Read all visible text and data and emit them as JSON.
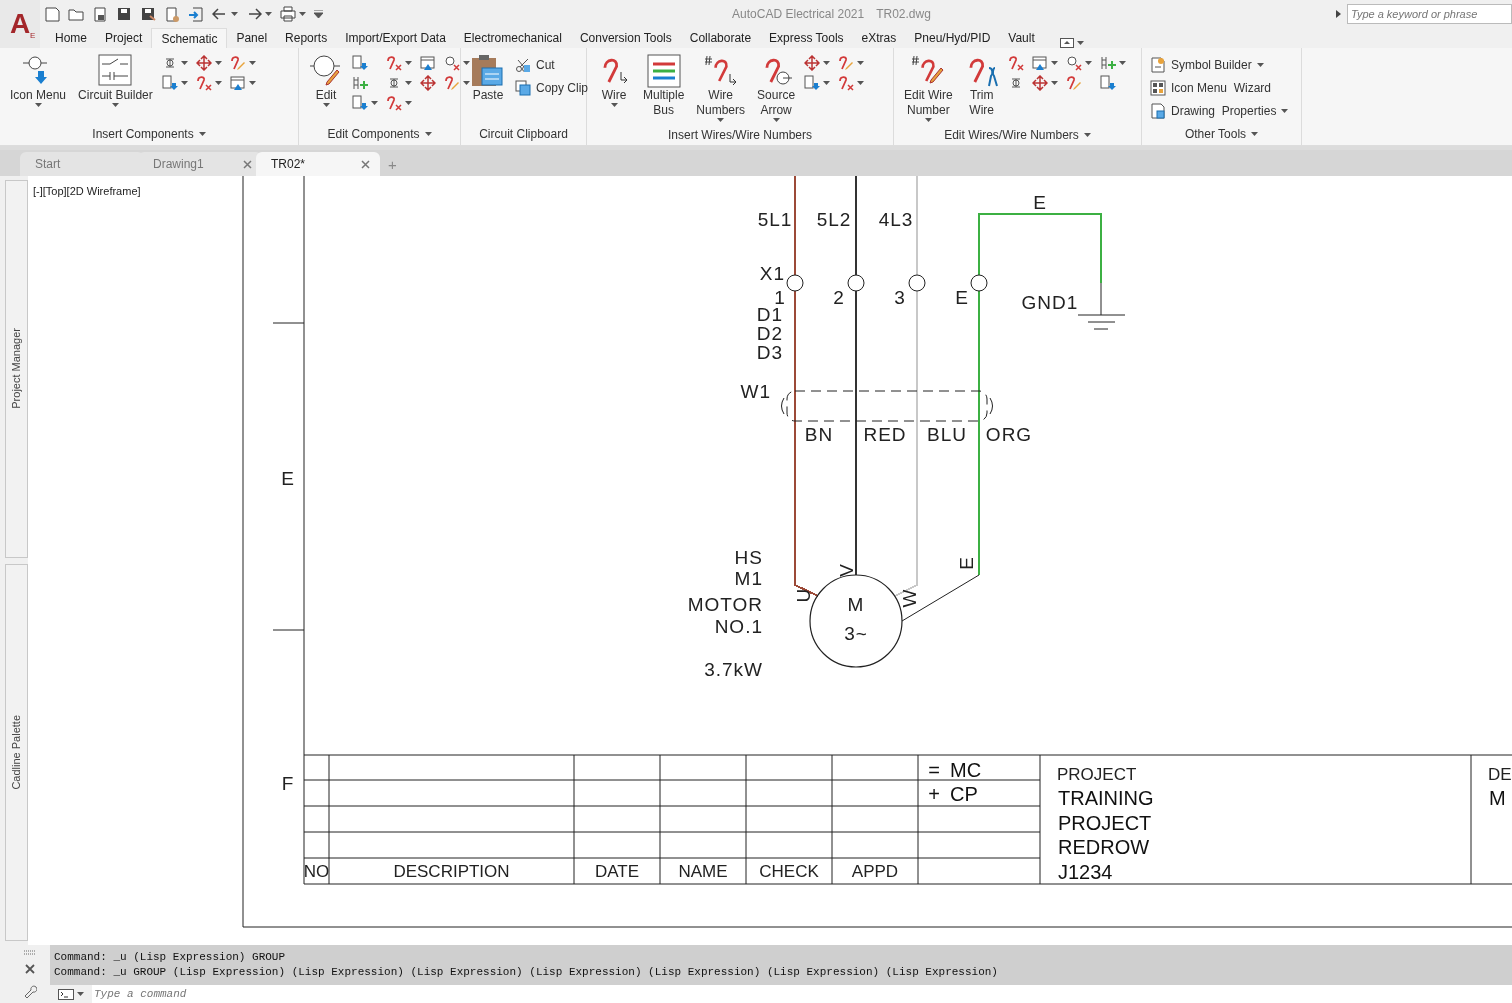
{
  "app": {
    "logo": "A",
    "logo_sub": "E",
    "title": "AutoCAD Electrical 2021",
    "file": "TR02.dwg"
  },
  "search": {
    "placeholder": "Type a keyword or phrase"
  },
  "ribbon_tabs": [
    {
      "label": "Home",
      "selected": false
    },
    {
      "label": "Project",
      "selected": false
    },
    {
      "label": "Schematic",
      "selected": true
    },
    {
      "label": "Panel",
      "selected": false
    },
    {
      "label": "Reports",
      "selected": false
    },
    {
      "label": "Import/Export Data",
      "selected": false
    },
    {
      "label": "Electromechanical",
      "selected": false
    },
    {
      "label": "Conversion Tools",
      "selected": false
    },
    {
      "label": "Collaborate",
      "selected": false
    },
    {
      "label": "Express Tools",
      "selected": false
    },
    {
      "label": "eXtras",
      "selected": false
    },
    {
      "label": "Pneu/Hyd/PID",
      "selected": false
    },
    {
      "label": "Vault",
      "selected": false
    }
  ],
  "ribbon_panels": [
    {
      "title": "Insert Components",
      "menu": true,
      "tools": [
        {
          "kind": "large",
          "label": "Icon Menu",
          "menu": true
        },
        {
          "kind": "large",
          "label": "Circuit Builder",
          "menu": true
        },
        {
          "kind": "icon",
          "menu": true
        },
        {
          "kind": "icon",
          "menu": true
        },
        {
          "kind": "icon",
          "menu": true
        },
        {
          "kind": "icon",
          "menu": true
        },
        {
          "kind": "icon",
          "menu": true
        },
        {
          "kind": "icon",
          "menu": true
        }
      ]
    },
    {
      "title": "Edit Components",
      "menu": true,
      "tools": [
        {
          "kind": "large",
          "label": "Edit",
          "menu": true
        },
        {
          "kind": "icon",
          "menu": false
        },
        {
          "kind": "icon",
          "menu": true
        },
        {
          "kind": "icon",
          "menu": false
        },
        {
          "kind": "icon",
          "menu": true
        },
        {
          "kind": "icon",
          "menu": false
        },
        {
          "kind": "icon",
          "menu": true
        },
        {
          "kind": "icon",
          "menu": false
        },
        {
          "kind": "icon",
          "menu": true
        },
        {
          "kind": "icon",
          "menu": true
        },
        {
          "kind": "icon",
          "menu": true
        }
      ]
    },
    {
      "title": "Circuit Clipboard",
      "menu": false,
      "tools": [
        {
          "kind": "large",
          "label": "Paste",
          "menu": false
        },
        {
          "kind": "small",
          "label": "Cut",
          "menu": false
        },
        {
          "kind": "small",
          "label": "Copy Clip",
          "menu": false
        }
      ]
    },
    {
      "title": "Insert Wires/Wire Numbers",
      "menu": false,
      "tools": [
        {
          "kind": "large",
          "label": "Wire",
          "menu": true
        },
        {
          "kind": "large",
          "label": "Multiple\nBus",
          "menu": false
        },
        {
          "kind": "large",
          "label": "Wire\nNumbers",
          "menu": true
        },
        {
          "kind": "large",
          "label": "Source\nArrow",
          "menu": true
        },
        {
          "kind": "icon",
          "menu": true
        },
        {
          "kind": "icon",
          "menu": true
        },
        {
          "kind": "icon",
          "menu": true
        },
        {
          "kind": "icon",
          "menu": true
        }
      ]
    },
    {
      "title": "Edit Wires/Wire Numbers",
      "menu": true,
      "tools": [
        {
          "kind": "large",
          "label": "Edit Wire\nNumber",
          "menu": true
        },
        {
          "kind": "large",
          "label": "Trim\nWire",
          "menu": false
        },
        {
          "kind": "icon",
          "menu": false
        },
        {
          "kind": "icon",
          "menu": true
        },
        {
          "kind": "icon",
          "menu": true
        },
        {
          "kind": "icon",
          "menu": true
        },
        {
          "kind": "icon",
          "menu": false
        },
        {
          "kind": "icon",
          "menu": true
        },
        {
          "kind": "icon",
          "menu": false
        },
        {
          "kind": "icon",
          "menu": false
        }
      ]
    },
    {
      "title": "Other Tools",
      "menu": true,
      "tools": [
        {
          "kind": "small",
          "label": "Symbol Builder",
          "menu": true
        },
        {
          "kind": "small",
          "label": "Icon Menu  Wizard",
          "menu": false
        },
        {
          "kind": "small",
          "label": "Drawing  Properties",
          "menu": true
        }
      ]
    }
  ],
  "document_tabs": [
    {
      "label": "Start",
      "selected": false,
      "closable": false
    },
    {
      "label": "Drawing1",
      "selected": false,
      "closable": true
    },
    {
      "label": "TR02*",
      "selected": true,
      "closable": true
    }
  ],
  "new_tab": "+",
  "side_palettes": [
    "Project Manager",
    "Cadline Palette"
  ],
  "viewport": {
    "label": "[-][Top][2D Wireframe]"
  },
  "schematic": {
    "zones": [
      "E",
      "F"
    ],
    "wires": [
      {
        "label": "5L1",
        "terminal": "1",
        "core": "BN",
        "pin": "U",
        "color": "#9c4a38"
      },
      {
        "label": "5L2",
        "terminal": "2",
        "core": "RED",
        "pin": "V",
        "color": "#333333"
      },
      {
        "label": "4L3",
        "terminal": "3",
        "core": "BLU",
        "pin": "W",
        "color": "#c8c8c8"
      },
      {
        "label": "E",
        "terminal": "E",
        "core": "ORG",
        "pin": "E",
        "color": "#3cb043"
      }
    ],
    "terminal_tag": "X1",
    "terminal_extra": [
      "D1",
      "D2",
      "D3"
    ],
    "cable_tag": "W1",
    "ground_tag": "GND1",
    "motor": {
      "tags": [
        "HS",
        "M1",
        "MOTOR",
        "NO.1"
      ],
      "rating": "3.7kW",
      "symbol": "M",
      "phases": "3~"
    }
  },
  "title_block": {
    "columns": [
      "NO",
      "DESCRIPTION",
      "DATE",
      "NAME",
      "CHECK",
      "APPD"
    ],
    "designations": [
      {
        "symbol": "=",
        "text": "MC"
      },
      {
        "symbol": "+",
        "text": "CP"
      }
    ],
    "project_label": "PROJECT",
    "project_lines": [
      "TRAINING",
      "PROJECT",
      "REDROW",
      "J1234"
    ],
    "cut_texts": [
      "DE",
      "M"
    ]
  },
  "command_line": {
    "history": [
      "Command: _u (Lisp Expression) GROUP",
      "Command: _u GROUP (Lisp Expression) (Lisp Expression) (Lisp Expression) (Lisp Expression) (Lisp Expression) (Lisp Expression) (Lisp Expression)"
    ],
    "placeholder": "Type a command"
  }
}
